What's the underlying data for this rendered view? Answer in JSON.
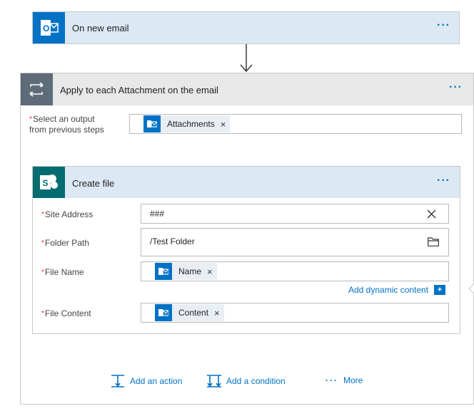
{
  "trigger": {
    "title": "On new email",
    "icon": "outlook-icon",
    "menu": "···"
  },
  "loop": {
    "title": "Apply to each Attachment on the email",
    "icon": "loop-icon",
    "menu": "···",
    "output_label_line1": "Select an output",
    "output_label_line2": "from previous steps",
    "output_token": "Attachments"
  },
  "create_file": {
    "title": "Create file",
    "icon": "sharepoint-icon",
    "menu": "···",
    "site_address_label": "Site Address",
    "site_address_value": "###",
    "folder_path_label": "Folder Path",
    "folder_path_value": "/Test Folder",
    "file_name_label": "File Name",
    "file_name_token": "Name",
    "add_dynamic": "Add dynamic content",
    "file_content_label": "File Content",
    "file_content_token": "Content"
  },
  "actions": {
    "add_action": "Add an action",
    "add_condition": "Add a condition",
    "more": "More",
    "more_dots": "···"
  },
  "colors": {
    "accent": "#0072c6",
    "required": "#d13438",
    "header_blue": "#dce8f4",
    "loop_icon_bg": "#5e6b78"
  }
}
